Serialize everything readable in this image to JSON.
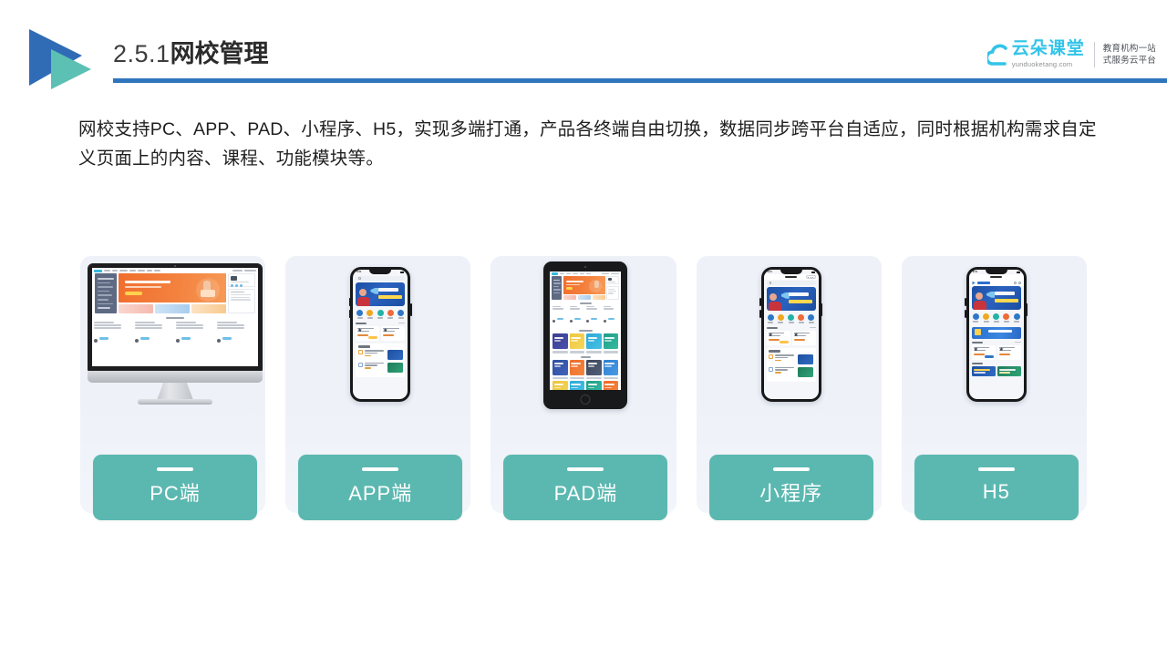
{
  "header": {
    "section_number": "2.5.1",
    "title_cn": "网校管理",
    "logo_mark_icon": "double-triangle-play-icon",
    "rule_color": "#2f75bc"
  },
  "brand": {
    "cloud_icon": "cloud-icon",
    "name": "云朵课堂",
    "url": "yunduoketang.com",
    "tagline_line1": "教育机构一站",
    "tagline_line2": "式服务云平台",
    "accent_color": "#32c4e8"
  },
  "body": {
    "paragraph": "网校支持PC、APP、PAD、小程序、H5，实现多端打通，产品各终端自由切换，数据同步跨平台自适应，同时根据机构需求自定义页面上的内容、课程、功能模块等。"
  },
  "cards": {
    "accent_color": "#5bb8b0",
    "background_color": "#eef1f8",
    "items": [
      {
        "label": "PC端",
        "device": "desktop",
        "device_icon": "imac-monitor-icon"
      },
      {
        "label": "APP端",
        "device": "phone",
        "device_icon": "smartphone-icon"
      },
      {
        "label": "PAD端",
        "device": "tablet",
        "device_icon": "tablet-icon"
      },
      {
        "label": "小程序",
        "device": "phone",
        "device_icon": "smartphone-miniprogram-icon"
      },
      {
        "label": "H5",
        "device": "phone",
        "device_icon": "smartphone-h5-icon"
      }
    ]
  }
}
